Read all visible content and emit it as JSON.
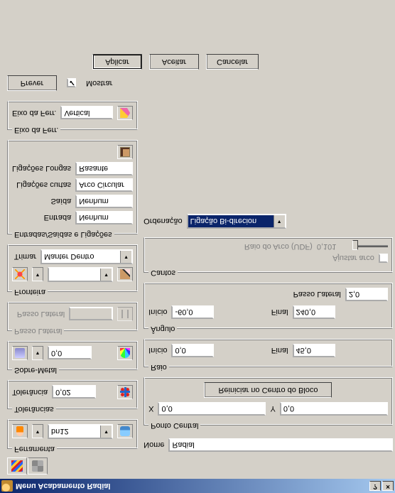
{
  "window": {
    "title": "Menu Acabamento Radial",
    "help": "?",
    "close": "×"
  },
  "nome_label": "Nome",
  "nome_value": "Radial",
  "ferramenta": {
    "legend": "Ferramenta",
    "value": "bn12",
    "dd_icon": "spark"
  },
  "tolerancias": {
    "legend": "Tolerâncias",
    "tolerancia_label": "Tolerância",
    "tolerancia_value": "0,02"
  },
  "sobremetal": {
    "legend": "Sobre-Metal",
    "value": "0,0"
  },
  "passo_lateral_l": {
    "legend": "Passo Lateral",
    "label": "Passo Lateral",
    "value": ""
  },
  "fronteira": {
    "legend": "Fronteira",
    "trimar_label": "Trimar",
    "trimar_value": "Manter Dentro"
  },
  "links": {
    "legend": "Entradas/Saídas e Ligações",
    "entrada_label": "Entrada",
    "entrada_value": "Nenhum",
    "saida_label": "Saída",
    "saida_value": "Nenhum",
    "curtas_label": "Ligações curtas",
    "curtas_value": "Arco Circular",
    "longas_label": "Ligações Longas",
    "longas_value": "Rasante"
  },
  "eixoferr": {
    "legend": "Eixo da Ferr.",
    "label": "Eixo da Ferr.",
    "value": "Vertical"
  },
  "prever_btn": "Prever",
  "mostrar_label": "Mostrar",
  "mostrar_checked": true,
  "ponto_central": {
    "legend": "Ponto Central",
    "x_label": "X",
    "x_value": "0,0",
    "y_label": "Y",
    "y_value": "0,0",
    "reiniciar": "Reiniciar no Centro do Bloco"
  },
  "raio": {
    "legend": "Raio",
    "inicio_label": "Início",
    "inicio_value": "0,0",
    "final_label": "Final",
    "final_value": "45,0"
  },
  "angulo": {
    "legend": "Ângulo",
    "inicio_label": "Início",
    "inicio_value": "-60,0",
    "final_label": "Final",
    "final_value": "240,0",
    "passo_label": "Passo Lateral",
    "passo_value": "2,0"
  },
  "cantos": {
    "legend": "Cantos",
    "ajustar_label": "Ajustar arco",
    "raio_arco_label": "Raio do Arco (UDF)",
    "raio_arco_value": "0,101"
  },
  "ordenacao_label": "Ordenação",
  "ordenacao_value": "Ligação Bi-direcion",
  "buttons": {
    "aplicar": "Aplicar",
    "aceitar": "Aceitar",
    "cancelar": "Cancelar"
  }
}
